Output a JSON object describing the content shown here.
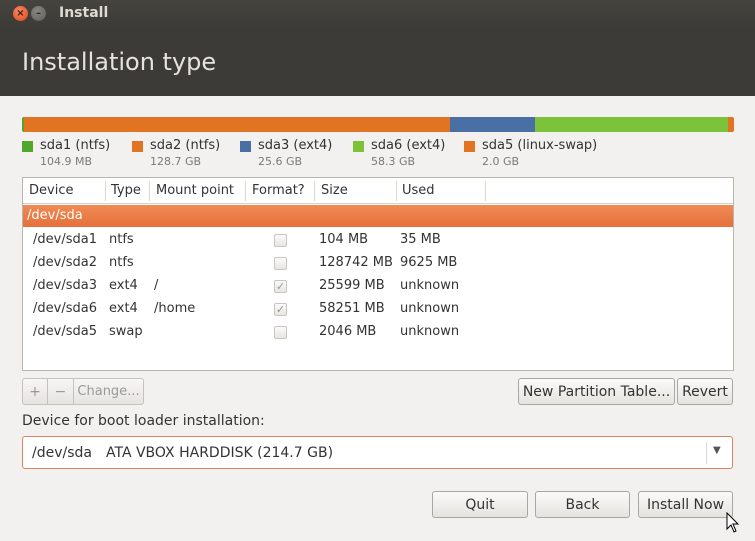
{
  "window": {
    "title": "Install",
    "close_glyph": "×",
    "minimize_glyph": "–"
  },
  "header": {
    "title": "Installation type"
  },
  "partition_bar": [
    {
      "name": "sda1 (ntfs)",
      "size": "104.9 MB",
      "color": "#4fa72c"
    },
    {
      "name": "sda2 (ntfs)",
      "size": "128.7 GB",
      "color": "#e07423"
    },
    {
      "name": "sda3 (ext4)",
      "size": "25.6 GB",
      "color": "#4a6fa5"
    },
    {
      "name": "sda6 (ext4)",
      "size": "58.3 GB",
      "color": "#7cc23a"
    },
    {
      "name": "sda5 (linux-swap)",
      "size": "2.0 GB",
      "color": "#e07423"
    }
  ],
  "table": {
    "columns": [
      "Device",
      "Type",
      "Mount point",
      "Format?",
      "Size",
      "Used"
    ],
    "selected_device": "/dev/sda",
    "rows": [
      {
        "device": "/dev/sda1",
        "type": "ntfs",
        "mount": "",
        "format": false,
        "size": "104 MB",
        "used": "35 MB"
      },
      {
        "device": "/dev/sda2",
        "type": "ntfs",
        "mount": "",
        "format": false,
        "size": "128742 MB",
        "used": "9625 MB"
      },
      {
        "device": "/dev/sda3",
        "type": "ext4",
        "mount": "/",
        "format": true,
        "size": "25599 MB",
        "used": "unknown"
      },
      {
        "device": "/dev/sda6",
        "type": "ext4",
        "mount": "/home",
        "format": true,
        "size": "58251 MB",
        "used": "unknown"
      },
      {
        "device": "/dev/sda5",
        "type": "swap",
        "mount": "",
        "format": false,
        "size": "2046 MB",
        "used": "unknown"
      }
    ]
  },
  "toolbar": {
    "add_label": "+",
    "remove_label": "−",
    "change_label": "Change...",
    "new_table_label": "New Partition Table...",
    "revert_label": "Revert"
  },
  "boot_loader": {
    "label": "Device for boot loader installation:",
    "device": "/dev/sda",
    "description": "ATA VBOX HARDDISK (214.7 GB)"
  },
  "buttons": {
    "quit": "Quit",
    "back": "Back",
    "install_now": "Install Now"
  },
  "colors": {
    "accent": "#e5703a",
    "header_bg": "#3c3b37"
  },
  "icons": {
    "check_mark": "✓",
    "dropdown_arrow": "▼"
  }
}
